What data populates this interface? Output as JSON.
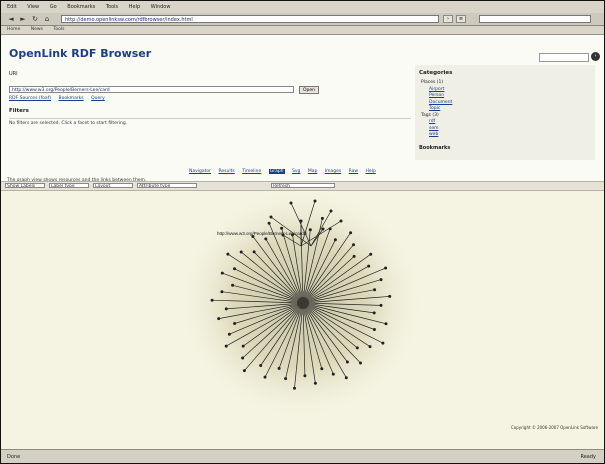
{
  "menu": [
    "Edit",
    "View",
    "Go",
    "Bookmarks",
    "Tools",
    "Help",
    "Window"
  ],
  "toolbar": {
    "url": "http://demo.openlinksw.com/rdfbrowser/index.html",
    "back": "◄",
    "forward": "►",
    "reload": "↻"
  },
  "bookmarks_bar": [
    "Home",
    "News",
    "Tools"
  ],
  "site": {
    "title": "OpenLink RDF Browser",
    "uri_label": "URI",
    "uri_value": "http://www.w3.org/People/Berners-Lee/card",
    "go_label": "Open",
    "links": [
      "RDF Sources (foaf)",
      "Bookmarks",
      "Query"
    ],
    "filters_title": "Filters",
    "filters_text": "No filters are selected. Click a facet to start filtering."
  },
  "categories": {
    "title": "Categories",
    "items": [
      {
        "label": "Places (1)",
        "sub": false
      },
      {
        "label": "Airport",
        "sub": true
      },
      {
        "label": "Person",
        "sub": true
      },
      {
        "label": "Document",
        "sub": true
      },
      {
        "label": "Topic",
        "sub": true
      },
      {
        "label": "Tags (3)",
        "sub": false
      },
      {
        "label": "rdf",
        "sub": true
      },
      {
        "label": "sem",
        "sub": true
      },
      {
        "label": "web",
        "sub": true
      }
    ],
    "bookmarks_label": "Bookmarks"
  },
  "tabs": [
    {
      "label": "Navigator",
      "active": false
    },
    {
      "label": "Results",
      "active": false
    },
    {
      "label": "Timeline",
      "active": false
    },
    {
      "label": "Graph",
      "active": true
    },
    {
      "label": "Svg",
      "active": false
    },
    {
      "label": "Map",
      "active": false
    },
    {
      "label": "Images",
      "active": false
    },
    {
      "label": "Raw",
      "active": false
    },
    {
      "label": "Help",
      "active": false
    }
  ],
  "info_line": "The graph view shows resources and the links between them.",
  "controls": [
    "Show Labels",
    "Label type",
    "Layout",
    "Attribute type",
    "Refresh"
  ],
  "graph": {
    "center_label": "http://www.w3.org/People/Berners-Lee/card#i"
  },
  "copyright": "Copyright © 2006-2007 OpenLink Software",
  "status": {
    "left": "Done",
    "right": "Ready"
  }
}
